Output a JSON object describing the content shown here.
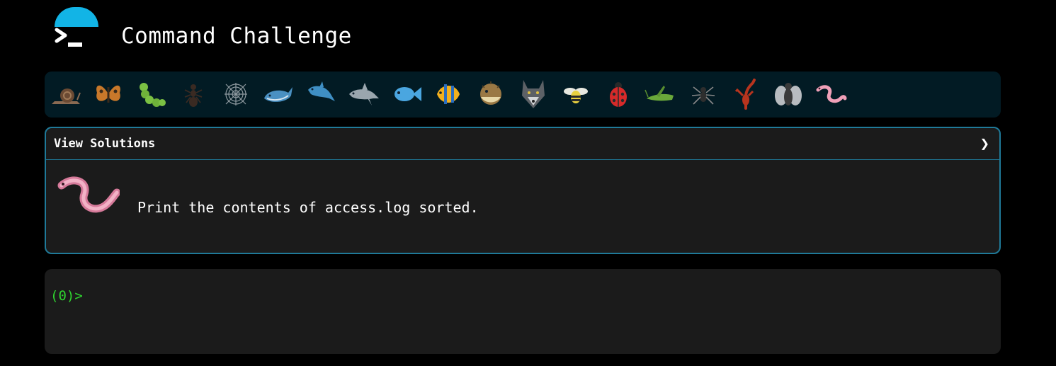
{
  "header": {
    "title": "Command Challenge",
    "accent_color": "#12b4e6",
    "logo_icon": "terminal-prompt-icon"
  },
  "critters": [
    {
      "name": "snail",
      "icon": "snail-icon"
    },
    {
      "name": "butterfly",
      "icon": "butterfly-icon"
    },
    {
      "name": "caterpillar",
      "icon": "caterpillar-icon"
    },
    {
      "name": "ant",
      "icon": "ant-icon"
    },
    {
      "name": "spider-web",
      "icon": "spider-web-icon"
    },
    {
      "name": "whale",
      "icon": "whale-icon"
    },
    {
      "name": "dolphin-blue",
      "icon": "dolphin-icon"
    },
    {
      "name": "dolphin-gray",
      "icon": "dolphin-icon"
    },
    {
      "name": "fish",
      "icon": "fish-icon"
    },
    {
      "name": "tropical-fish",
      "icon": "tropical-fish-icon"
    },
    {
      "name": "blowfish",
      "icon": "blowfish-icon"
    },
    {
      "name": "wolf",
      "icon": "wolf-icon"
    },
    {
      "name": "bee",
      "icon": "bee-icon"
    },
    {
      "name": "ladybug",
      "icon": "ladybug-icon"
    },
    {
      "name": "cricket",
      "icon": "cricket-icon"
    },
    {
      "name": "spider",
      "icon": "spider-icon"
    },
    {
      "name": "scorpion",
      "icon": "scorpion-icon"
    },
    {
      "name": "fly",
      "icon": "fly-icon"
    },
    {
      "name": "worm",
      "icon": "worm-icon"
    }
  ],
  "challenge": {
    "solutions_label": "View Solutions",
    "chevron": "❯",
    "critter_icon": "worm-icon",
    "task": "Print the contents of access.log sorted.",
    "border_color": "#1f7a99"
  },
  "terminal": {
    "prompt": "(0)>",
    "prompt_color": "#2fd32f"
  }
}
